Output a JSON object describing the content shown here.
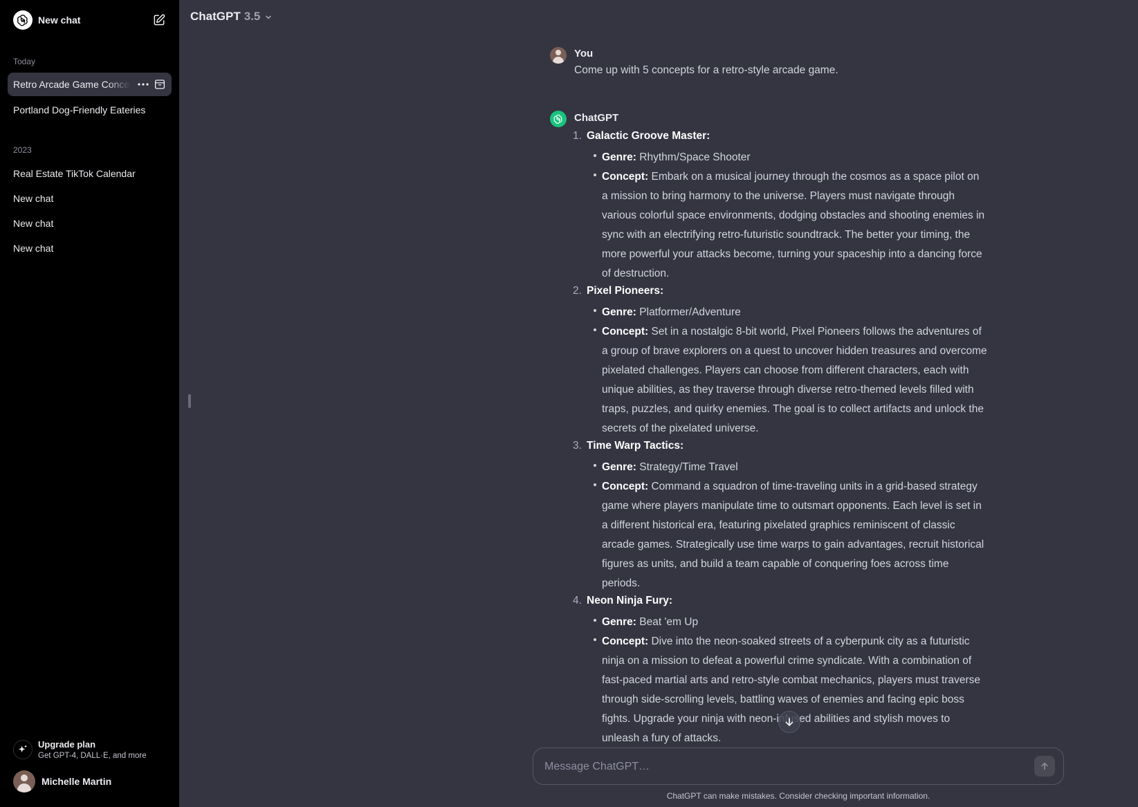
{
  "sidebar": {
    "new_chat_label": "New chat",
    "sections": [
      {
        "label": "Today",
        "items": [
          {
            "label": "Retro Arcade Game Concepts",
            "active": true
          },
          {
            "label": "Portland Dog-Friendly Eateries",
            "active": false
          }
        ]
      },
      {
        "label": "2023",
        "items": [
          {
            "label": "Real Estate TikTok Calendar",
            "active": false
          },
          {
            "label": "New chat",
            "active": false
          },
          {
            "label": "New chat",
            "active": false
          },
          {
            "label": "New chat",
            "active": false
          }
        ]
      }
    ],
    "more_icon": "ellipsis-icon",
    "archive_icon": "archive-icon",
    "upgrade": {
      "title": "Upgrade plan",
      "subtitle": "Get GPT-4, DALL·E, and more"
    },
    "user": {
      "name": "Michelle Martin"
    }
  },
  "header": {
    "model_name": "ChatGPT",
    "model_version": "3.5"
  },
  "conversation": {
    "user_message": {
      "author": "You",
      "text": "Come up with 5 concepts for a retro-style arcade game."
    },
    "assistant_message": {
      "author": "ChatGPT",
      "items": [
        {
          "num": "1.",
          "title": "Galactic Groove Master:",
          "genre_label": "Genre:",
          "genre": "Rhythm/Space Shooter",
          "concept_label": "Concept:",
          "concept": "Embark on a musical journey through the cosmos as a space pilot on a mission to bring harmony to the universe. Players must navigate through various colorful space environments, dodging obstacles and shooting enemies in sync with an electrifying retro-futuristic soundtrack. The better your timing, the more powerful your attacks become, turning your spaceship into a dancing force of destruction."
        },
        {
          "num": "2.",
          "title": "Pixel Pioneers:",
          "genre_label": "Genre:",
          "genre": "Platformer/Adventure",
          "concept_label": "Concept:",
          "concept": "Set in a nostalgic 8-bit world, Pixel Pioneers follows the adventures of a group of brave explorers on a quest to uncover hidden treasures and overcome pixelated challenges. Players can choose from different characters, each with unique abilities, as they traverse through diverse retro-themed levels filled with traps, puzzles, and quirky enemies. The goal is to collect artifacts and unlock the secrets of the pixelated universe."
        },
        {
          "num": "3.",
          "title": "Time Warp Tactics:",
          "genre_label": "Genre:",
          "genre": "Strategy/Time Travel",
          "concept_label": "Concept:",
          "concept": "Command a squadron of time-traveling units in a grid-based strategy game where players manipulate time to outsmart opponents. Each level is set in a different historical era, featuring pixelated graphics reminiscent of classic arcade games. Strategically use time warps to gain advantages, recruit historical figures as units, and build a team capable of conquering foes across time periods."
        },
        {
          "num": "4.",
          "title": "Neon Ninja Fury:",
          "genre_label": "Genre:",
          "genre": "Beat 'em Up",
          "concept_label": "Concept:",
          "concept": "Dive into the neon-soaked streets of a cyberpunk city as a futuristic ninja on a mission to defeat a powerful crime syndicate. With a combination of fast-paced martial arts and retro-style combat mechanics, players must traverse through side-scrolling levels, battling waves of enemies and facing epic boss fights. Upgrade your ninja with neon-infused abilities and stylish moves to unleash a fury of attacks."
        }
      ]
    }
  },
  "composer": {
    "placeholder": "Message ChatGPT…",
    "value": ""
  },
  "disclaimer": "ChatGPT can make mistakes. Consider checking important information.",
  "colors": {
    "sidebar_bg": "#000000",
    "main_bg": "#343541",
    "assistant_avatar": "#19c37d",
    "user_avatar": "#7a5f57"
  }
}
